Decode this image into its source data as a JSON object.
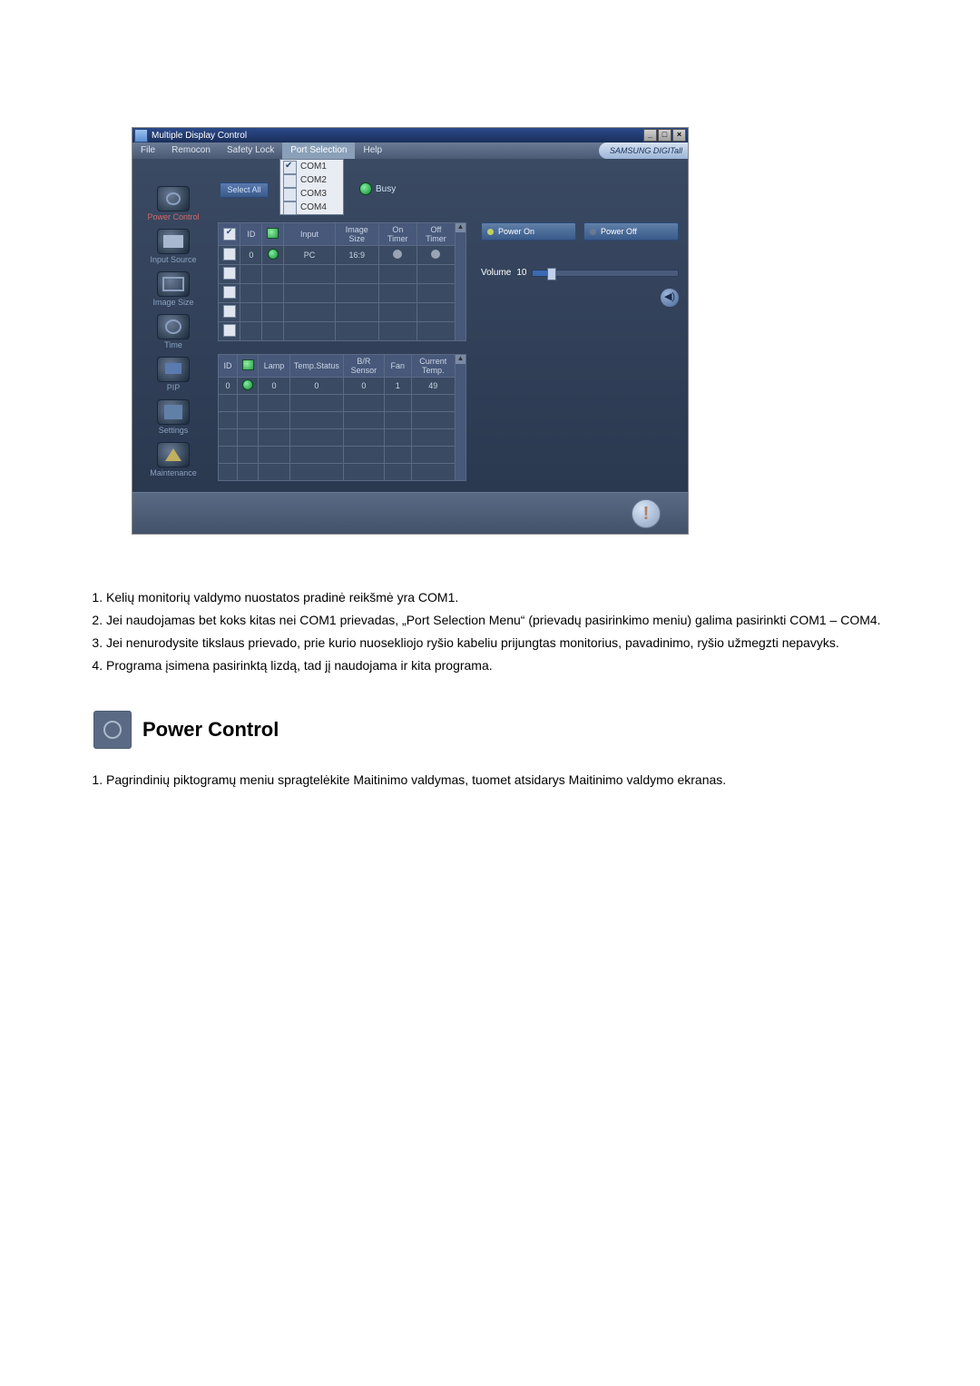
{
  "screenshot": {
    "title": "Multiple Display Control",
    "menu": {
      "file": "File",
      "remocon": "Remocon",
      "safety": "Safety Lock",
      "port": "Port Selection",
      "help": "Help"
    },
    "brand": "SAMSUNG DIGITall",
    "port_dropdown": {
      "items": [
        "COM1",
        "COM2",
        "COM3",
        "COM4"
      ],
      "selected_index": 0
    },
    "sidebar": {
      "power": "Power Control",
      "input": "Input Source",
      "image": "Image Size",
      "time": "Time",
      "pip": "PIP",
      "settings": "Settings",
      "maint": "Maintenance"
    },
    "select_all": "Select All",
    "busy": "Busy",
    "table1": {
      "headers": {
        "id": "ID",
        "input": "Input",
        "isize": "Image Size",
        "ontimer": "On Timer",
        "offtimer": "Off Timer"
      },
      "row": {
        "id": "0",
        "input": "PC",
        "isize": "16:9"
      }
    },
    "table2": {
      "headers": {
        "id": "ID",
        "lamp": "Lamp",
        "temp": "Temp.Status",
        "br": "B/R Sensor",
        "fan": "Fan",
        "cur": "Current Temp."
      },
      "row": {
        "id": "0",
        "lamp": "0",
        "temp": "0",
        "br": "0",
        "fan": "1",
        "cur": "49"
      }
    },
    "right": {
      "power_on": "Power On",
      "power_off": "Power Off",
      "volume_label": "Volume",
      "volume_value": "10"
    }
  },
  "notes": [
    "Kelių monitorių valdymo nuostatos pradinė reikšmė yra COM1.",
    "Jei naudojamas bet koks kitas nei COM1 prievadas, „Port Selection Menu“ (prievadų pasirinkimo meniu) galima pasirinkti COM1 – COM4.",
    "Jei nenurodysite tikslaus prievado, prie kurio nuosekliojo ryšio kabeliu prijungtas monitorius, pavadinimo, ryšio užmegzti nepavyks.",
    "Programa įsimena pasirinktą lizdą, tad jį naudojama ir kita programa."
  ],
  "section_title": "Power Control",
  "notes2": [
    "Pagrindinių piktogramų meniu spragtelėkite Maitinimo valdymas, tuomet atsidarys Maitinimo valdymo ekranas."
  ]
}
